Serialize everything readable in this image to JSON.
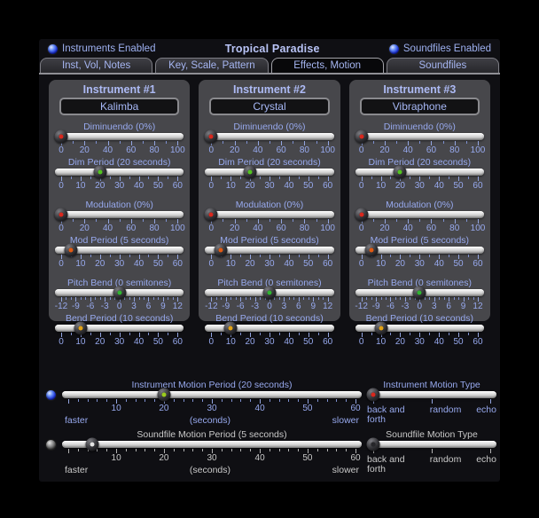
{
  "header": {
    "title": "Tropical Paradise",
    "instruments_enabled": {
      "label": "Instruments Enabled",
      "checked": true
    },
    "soundfiles_enabled": {
      "label": "Soundfiles Enabled",
      "checked": true
    }
  },
  "tabs": [
    {
      "label": "Inst, Vol, Notes",
      "active": false
    },
    {
      "label": "Key, Scale, Pattern",
      "active": false
    },
    {
      "label": "Effects, Motion",
      "active": true
    },
    {
      "label": "Soundfiles",
      "active": false
    }
  ],
  "colors": {
    "accent_text": "#97a9ee",
    "title_text": "#b9c4f7",
    "disabled_text": "#c9c9c9",
    "panel_bg": "#47474b",
    "window_bg": "#0f0f13",
    "led_on": "#2d4cf0",
    "led_off": "#777777",
    "dot_red": "#d8281e",
    "dot_green": "#52c41f",
    "dot_orange": "#e05a12",
    "dot_amber": "#e2a216",
    "dot_lime": "#9bcc1d",
    "dot_white": "#e4e4e4"
  },
  "panels": [
    {
      "title": "Instrument #1",
      "instrument": "Kalimba",
      "sliders": [
        {
          "name": "diminuendo",
          "label": "Diminuendo (0%)",
          "value_pct": 0,
          "dot": "#d8281e",
          "tick_count": 11,
          "major_every": 2,
          "numbers": [
            {
              "t": "0",
              "p": 0
            },
            {
              "t": "20",
              "p": 20
            },
            {
              "t": "40",
              "p": 40
            },
            {
              "t": "60",
              "p": 60
            },
            {
              "t": "80",
              "p": 80
            },
            {
              "t": "100",
              "p": 100
            }
          ]
        },
        {
          "name": "dim-period",
          "label": "Dim Period (20 seconds)",
          "value_pct": 33.3,
          "dot": "#52c41f",
          "tick_count": 13,
          "major_every": 2,
          "numbers": [
            {
              "t": "0",
              "p": 0
            },
            {
              "t": "10",
              "p": 16.7
            },
            {
              "t": "20",
              "p": 33.3
            },
            {
              "t": "30",
              "p": 50
            },
            {
              "t": "40",
              "p": 66.7
            },
            {
              "t": "50",
              "p": 83.3
            },
            {
              "t": "60",
              "p": 100
            }
          ]
        },
        {
          "name": "modulation",
          "label": "Modulation (0%)",
          "value_pct": 0,
          "dot": "#d8281e",
          "tick_count": 11,
          "major_every": 2,
          "gap": true,
          "numbers": [
            {
              "t": "0",
              "p": 0
            },
            {
              "t": "20",
              "p": 20
            },
            {
              "t": "40",
              "p": 40
            },
            {
              "t": "60",
              "p": 60
            },
            {
              "t": "80",
              "p": 80
            },
            {
              "t": "100",
              "p": 100
            }
          ]
        },
        {
          "name": "mod-period",
          "label": "Mod Period (5 seconds)",
          "value_pct": 8.3,
          "dot": "#e05a12",
          "tick_count": 13,
          "major_every": 2,
          "numbers": [
            {
              "t": "0",
              "p": 0
            },
            {
              "t": "10",
              "p": 16.7
            },
            {
              "t": "20",
              "p": 33.3
            },
            {
              "t": "30",
              "p": 50
            },
            {
              "t": "40",
              "p": 66.7
            },
            {
              "t": "50",
              "p": 83.3
            },
            {
              "t": "60",
              "p": 100
            }
          ]
        },
        {
          "name": "pitch-bend",
          "label": "Pitch Bend (0 semitones)",
          "value_pct": 50,
          "dot": "#2fb431",
          "tick_count": 25,
          "major_every": 3,
          "gap": true,
          "numbers": [
            {
              "t": "-12",
              "p": 0
            },
            {
              "t": "-9",
              "p": 12.5
            },
            {
              "t": "-6",
              "p": 25
            },
            {
              "t": "-3",
              "p": 37.5
            },
            {
              "t": "0",
              "p": 50
            },
            {
              "t": "3",
              "p": 62.5
            },
            {
              "t": "6",
              "p": 75
            },
            {
              "t": "9",
              "p": 87.5
            },
            {
              "t": "12",
              "p": 100
            }
          ]
        },
        {
          "name": "bend-period",
          "label": "Bend Period (10 seconds)",
          "value_pct": 16.7,
          "dot": "#e2a216",
          "tick_count": 13,
          "major_every": 2,
          "numbers": [
            {
              "t": "0",
              "p": 0
            },
            {
              "t": "10",
              "p": 16.7
            },
            {
              "t": "20",
              "p": 33.3
            },
            {
              "t": "30",
              "p": 50
            },
            {
              "t": "40",
              "p": 66.7
            },
            {
              "t": "50",
              "p": 83.3
            },
            {
              "t": "60",
              "p": 100
            }
          ]
        }
      ]
    },
    {
      "title": "Instrument #2",
      "instrument": "Crystal",
      "sliders": [
        {
          "name": "diminuendo",
          "label": "Diminuendo (0%)",
          "value_pct": 0,
          "dot": "#d8281e",
          "tick_count": 11,
          "major_every": 2,
          "numbers": [
            {
              "t": "0",
              "p": 0
            },
            {
              "t": "20",
              "p": 20
            },
            {
              "t": "40",
              "p": 40
            },
            {
              "t": "60",
              "p": 60
            },
            {
              "t": "80",
              "p": 80
            },
            {
              "t": "100",
              "p": 100
            }
          ]
        },
        {
          "name": "dim-period",
          "label": "Dim Period (20 seconds)",
          "value_pct": 33.3,
          "dot": "#52c41f",
          "tick_count": 13,
          "major_every": 2,
          "numbers": [
            {
              "t": "0",
              "p": 0
            },
            {
              "t": "10",
              "p": 16.7
            },
            {
              "t": "20",
              "p": 33.3
            },
            {
              "t": "30",
              "p": 50
            },
            {
              "t": "40",
              "p": 66.7
            },
            {
              "t": "50",
              "p": 83.3
            },
            {
              "t": "60",
              "p": 100
            }
          ]
        },
        {
          "name": "modulation",
          "label": "Modulation (0%)",
          "value_pct": 0,
          "dot": "#d8281e",
          "tick_count": 11,
          "major_every": 2,
          "gap": true,
          "numbers": [
            {
              "t": "0",
              "p": 0
            },
            {
              "t": "20",
              "p": 20
            },
            {
              "t": "40",
              "p": 40
            },
            {
              "t": "60",
              "p": 60
            },
            {
              "t": "80",
              "p": 80
            },
            {
              "t": "100",
              "p": 100
            }
          ]
        },
        {
          "name": "mod-period",
          "label": "Mod Period (5 seconds)",
          "value_pct": 8.3,
          "dot": "#e05a12",
          "tick_count": 13,
          "major_every": 2,
          "numbers": [
            {
              "t": "0",
              "p": 0
            },
            {
              "t": "10",
              "p": 16.7
            },
            {
              "t": "20",
              "p": 33.3
            },
            {
              "t": "30",
              "p": 50
            },
            {
              "t": "40",
              "p": 66.7
            },
            {
              "t": "50",
              "p": 83.3
            },
            {
              "t": "60",
              "p": 100
            }
          ]
        },
        {
          "name": "pitch-bend",
          "label": "Pitch Bend (0 semitones)",
          "value_pct": 50,
          "dot": "#2fb431",
          "tick_count": 25,
          "major_every": 3,
          "gap": true,
          "numbers": [
            {
              "t": "-12",
              "p": 0
            },
            {
              "t": "-9",
              "p": 12.5
            },
            {
              "t": "-6",
              "p": 25
            },
            {
              "t": "-3",
              "p": 37.5
            },
            {
              "t": "0",
              "p": 50
            },
            {
              "t": "3",
              "p": 62.5
            },
            {
              "t": "6",
              "p": 75
            },
            {
              "t": "9",
              "p": 87.5
            },
            {
              "t": "12",
              "p": 100
            }
          ]
        },
        {
          "name": "bend-period",
          "label": "Bend Period (10 seconds)",
          "value_pct": 16.7,
          "dot": "#e2a216",
          "tick_count": 13,
          "major_every": 2,
          "numbers": [
            {
              "t": "0",
              "p": 0
            },
            {
              "t": "10",
              "p": 16.7
            },
            {
              "t": "20",
              "p": 33.3
            },
            {
              "t": "30",
              "p": 50
            },
            {
              "t": "40",
              "p": 66.7
            },
            {
              "t": "50",
              "p": 83.3
            },
            {
              "t": "60",
              "p": 100
            }
          ]
        }
      ]
    },
    {
      "title": "Instrument #3",
      "instrument": "Vibraphone",
      "sliders": [
        {
          "name": "diminuendo",
          "label": "Diminuendo (0%)",
          "value_pct": 0,
          "dot": "#d8281e",
          "tick_count": 11,
          "major_every": 2,
          "numbers": [
            {
              "t": "0",
              "p": 0
            },
            {
              "t": "20",
              "p": 20
            },
            {
              "t": "40",
              "p": 40
            },
            {
              "t": "60",
              "p": 60
            },
            {
              "t": "80",
              "p": 80
            },
            {
              "t": "100",
              "p": 100
            }
          ]
        },
        {
          "name": "dim-period",
          "label": "Dim Period (20 seconds)",
          "value_pct": 33.3,
          "dot": "#52c41f",
          "tick_count": 13,
          "major_every": 2,
          "numbers": [
            {
              "t": "0",
              "p": 0
            },
            {
              "t": "10",
              "p": 16.7
            },
            {
              "t": "20",
              "p": 33.3
            },
            {
              "t": "30",
              "p": 50
            },
            {
              "t": "40",
              "p": 66.7
            },
            {
              "t": "50",
              "p": 83.3
            },
            {
              "t": "60",
              "p": 100
            }
          ]
        },
        {
          "name": "modulation",
          "label": "Modulation (0%)",
          "value_pct": 0,
          "dot": "#d8281e",
          "tick_count": 11,
          "major_every": 2,
          "gap": true,
          "numbers": [
            {
              "t": "0",
              "p": 0
            },
            {
              "t": "20",
              "p": 20
            },
            {
              "t": "40",
              "p": 40
            },
            {
              "t": "60",
              "p": 60
            },
            {
              "t": "80",
              "p": 80
            },
            {
              "t": "100",
              "p": 100
            }
          ]
        },
        {
          "name": "mod-period",
          "label": "Mod Period (5 seconds)",
          "value_pct": 8.3,
          "dot": "#e05a12",
          "tick_count": 13,
          "major_every": 2,
          "numbers": [
            {
              "t": "0",
              "p": 0
            },
            {
              "t": "10",
              "p": 16.7
            },
            {
              "t": "20",
              "p": 33.3
            },
            {
              "t": "30",
              "p": 50
            },
            {
              "t": "40",
              "p": 66.7
            },
            {
              "t": "50",
              "p": 83.3
            },
            {
              "t": "60",
              "p": 100
            }
          ]
        },
        {
          "name": "pitch-bend",
          "label": "Pitch Bend (0 semitones)",
          "value_pct": 50,
          "dot": "#2fb431",
          "tick_count": 25,
          "major_every": 3,
          "gap": true,
          "numbers": [
            {
              "t": "-12",
              "p": 0
            },
            {
              "t": "-9",
              "p": 12.5
            },
            {
              "t": "-6",
              "p": 25
            },
            {
              "t": "-3",
              "p": 37.5
            },
            {
              "t": "0",
              "p": 50
            },
            {
              "t": "3",
              "p": 62.5
            },
            {
              "t": "6",
              "p": 75
            },
            {
              "t": "9",
              "p": 87.5
            },
            {
              "t": "12",
              "p": 100
            }
          ]
        },
        {
          "name": "bend-period",
          "label": "Bend Period (10 seconds)",
          "value_pct": 16.7,
          "dot": "#e2a216",
          "tick_count": 13,
          "major_every": 2,
          "numbers": [
            {
              "t": "0",
              "p": 0
            },
            {
              "t": "10",
              "p": 16.7
            },
            {
              "t": "20",
              "p": 33.3
            },
            {
              "t": "30",
              "p": 50
            },
            {
              "t": "40",
              "p": 66.7
            },
            {
              "t": "50",
              "p": 83.3
            },
            {
              "t": "60",
              "p": 100
            }
          ]
        }
      ]
    }
  ],
  "motion_rows": [
    {
      "name": "instrument-motion",
      "led_on": true,
      "disabled": false,
      "period": {
        "name": "instrument-motion-period",
        "label": "Instrument Motion Period (20 seconds)",
        "value_pct": 33.3,
        "dot": "#9bcc1d",
        "tick_count": 31,
        "major_every": 5,
        "numbers": [
          {
            "t": "10",
            "p": 16.7
          },
          {
            "t": "20",
            "p": 33.3
          },
          {
            "t": "30",
            "p": 50
          },
          {
            "t": "40",
            "p": 66.7
          },
          {
            "t": "50",
            "p": 83.3
          },
          {
            "t": "60",
            "p": 100
          }
        ],
        "left_label": "faster",
        "center_label": "(seconds)",
        "right_label": "slower"
      },
      "type_slider": {
        "name": "instrument-motion-type",
        "label": "Instrument Motion Type",
        "value_pct": 0,
        "dot": "#d8281e",
        "tick_count": 3,
        "major_every": 1,
        "compact": true,
        "options": [
          "back and forth",
          "random",
          "echo"
        ],
        "selected": "back and forth"
      }
    },
    {
      "name": "soundfile-motion",
      "led_on": false,
      "disabled": true,
      "period": {
        "name": "soundfile-motion-period",
        "label": "Soundfile Motion Period (5 seconds)",
        "value_pct": 8.3,
        "dot": "#e4e4e4",
        "tick_count": 31,
        "major_every": 5,
        "numbers": [
          {
            "t": "10",
            "p": 16.7
          },
          {
            "t": "20",
            "p": 33.3
          },
          {
            "t": "30",
            "p": 50
          },
          {
            "t": "40",
            "p": 66.7
          },
          {
            "t": "50",
            "p": 83.3
          },
          {
            "t": "60",
            "p": 100
          }
        ],
        "left_label": "faster",
        "center_label": "(seconds)",
        "right_label": "slower"
      },
      "type_slider": {
        "name": "soundfile-motion-type",
        "label": "Soundfile Motion Type",
        "value_pct": 0,
        "dot": "#26262a",
        "tick_count": 3,
        "major_every": 1,
        "compact": true,
        "options": [
          "back and forth",
          "random",
          "echo"
        ],
        "selected": "back and forth"
      }
    }
  ]
}
